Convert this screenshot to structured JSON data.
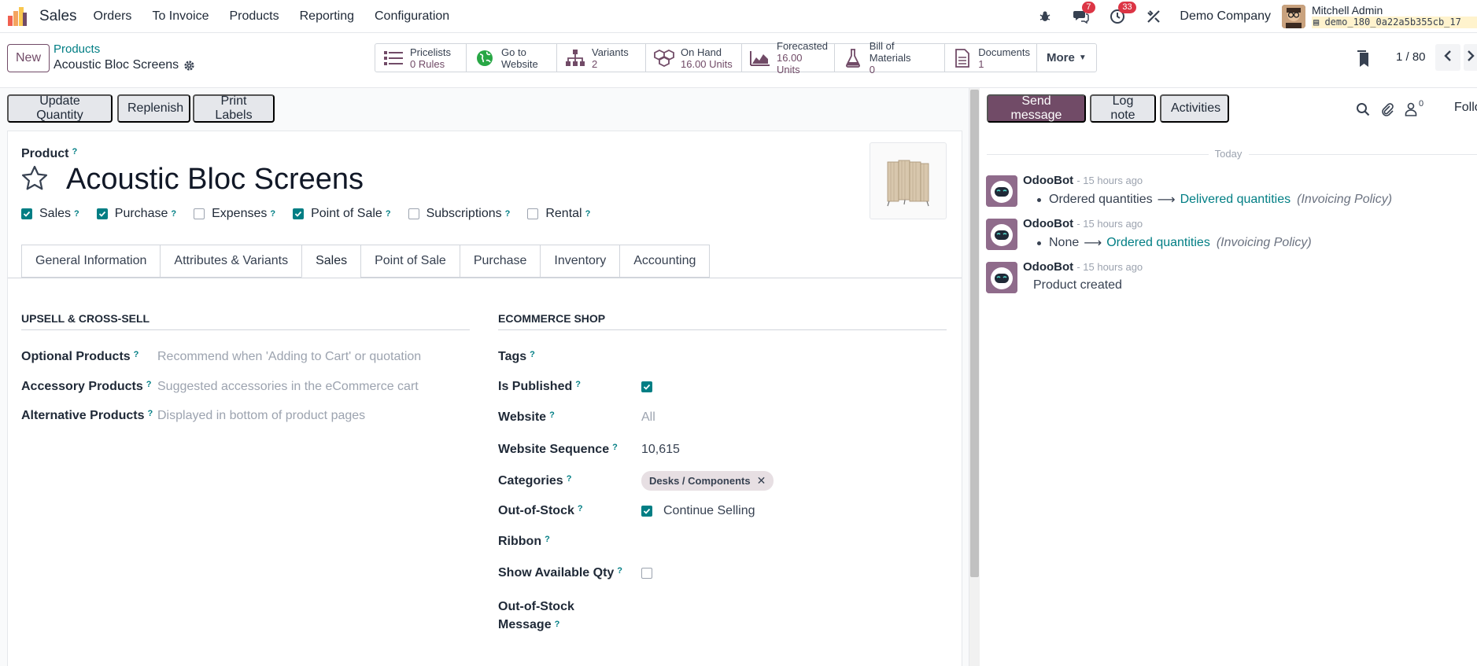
{
  "app": {
    "name": "Sales"
  },
  "menu": [
    "Orders",
    "To Invoice",
    "Products",
    "Reporting",
    "Configuration"
  ],
  "nav": {
    "messages_badge": "7",
    "activities_badge": "33",
    "company": "Demo Company",
    "user_name": "Mitchell Admin",
    "db_name": "demo_180_0a22a5b355cb_17"
  },
  "control": {
    "new_label": "New",
    "breadcrumb_parent": "Products",
    "breadcrumb_current": "Acoustic Bloc Screens",
    "pager": "1 / 80",
    "more_label": "More"
  },
  "smart_buttons": [
    {
      "name": "pricelists",
      "line1": "Pricelists",
      "line2": "0 Rules"
    },
    {
      "name": "go-to-website",
      "line1": "Go to",
      "line2": "Website"
    },
    {
      "name": "variants",
      "line1": "Variants",
      "line2": "2"
    },
    {
      "name": "on-hand",
      "line1": "On Hand",
      "line2": "16.00 Units"
    },
    {
      "name": "forecasted",
      "line1": "Forecasted",
      "line2": "16.00 Units"
    },
    {
      "name": "bill-of-materials",
      "line1": "Bill of Materials",
      "line2": "0"
    },
    {
      "name": "documents",
      "line1": "Documents",
      "line2": "1"
    }
  ],
  "actions": [
    "Update Quantity",
    "Replenish",
    "Print Labels"
  ],
  "product": {
    "label": "Product",
    "help": "?",
    "name": "Acoustic Bloc Screens",
    "flags": [
      {
        "label": "Sales",
        "checked": true
      },
      {
        "label": "Purchase",
        "checked": true
      },
      {
        "label": "Expenses",
        "checked": false
      },
      {
        "label": "Point of Sale",
        "checked": true
      },
      {
        "label": "Subscriptions",
        "checked": false
      },
      {
        "label": "Rental",
        "checked": false
      }
    ]
  },
  "tabs": [
    "General Information",
    "Attributes & Variants",
    "Sales",
    "Point of Sale",
    "Purchase",
    "Inventory",
    "Accounting"
  ],
  "upsell": {
    "title": "UPSELL & CROSS-SELL",
    "optional_label": "Optional Products",
    "optional_ph": "Recommend when 'Adding to Cart' or quotation",
    "accessory_label": "Accessory Products",
    "accessory_ph": "Suggested accessories in the eCommerce cart",
    "alternative_label": "Alternative Products",
    "alternative_ph": "Displayed in bottom of product pages"
  },
  "ecommerce": {
    "title": "ECOMMERCE SHOP",
    "tags_label": "Tags",
    "published_label": "Is Published",
    "website_label": "Website",
    "website_ph": "All",
    "sequence_label": "Website Sequence",
    "sequence_value": "10,615",
    "categories_label": "Categories",
    "category_tag": "Desks / Components",
    "oos_label": "Out-of-Stock",
    "oos_value": "Continue Selling",
    "ribbon_label": "Ribbon",
    "show_qty_label": "Show Available Qty",
    "oos_msg_label_1": "Out-of-Stock",
    "oos_msg_label_2": "Message"
  },
  "chatter": {
    "send_message": "Send message",
    "log_note": "Log note",
    "activities": "Activities",
    "followers_count": "0",
    "follow_label": "Follo",
    "today": "Today",
    "messages": [
      {
        "author": "OdooBot",
        "time": "- 15 hours ago",
        "old": "Ordered quantities",
        "new": "Delivered quantities",
        "field": "(Invoicing Policy)"
      },
      {
        "author": "OdooBot",
        "time": "- 15 hours ago",
        "old": "None",
        "new": "Ordered quantities",
        "field": "(Invoicing Policy)"
      },
      {
        "author": "OdooBot",
        "time": "- 15 hours ago",
        "text": "Product created"
      }
    ]
  },
  "colors": {
    "brand": "#714b67",
    "accent": "#017e84",
    "badge": "#dc3545"
  }
}
